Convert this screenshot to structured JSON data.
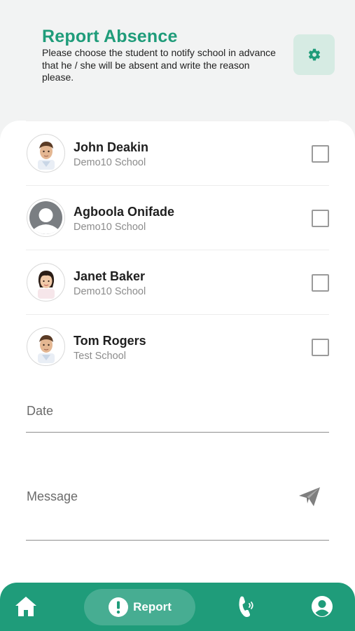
{
  "header": {
    "title": "Report Absence",
    "subtitle": "Please choose the student to notify school in advance that he / she will be absent and write the reason please.",
    "settings_icon": "gear-icon"
  },
  "students": [
    {
      "name": "John Deakin",
      "school": "Demo10 School",
      "avatar": "boy-photo",
      "checked": false
    },
    {
      "name": "Agboola Onifade",
      "school": "Demo10 School",
      "avatar": "placeholder-person-icon",
      "checked": false
    },
    {
      "name": "Janet Baker",
      "school": "Demo10 School",
      "avatar": "girl-photo",
      "checked": false
    },
    {
      "name": "Tom Rogers",
      "school": "Test School",
      "avatar": "boy-photo",
      "checked": false
    }
  ],
  "form": {
    "date_placeholder": "Date",
    "message_placeholder": "Message",
    "send_icon": "paper-plane-icon"
  },
  "nav": {
    "home_icon": "home-icon",
    "report_label": "Report",
    "report_icon": "exclamation-circle-icon",
    "call_icon": "phone-icon",
    "profile_icon": "user-circle-icon"
  },
  "colors": {
    "accent": "#1f9c7a",
    "accent_light": "#d6ebe3",
    "background": "#f2f3f3"
  }
}
